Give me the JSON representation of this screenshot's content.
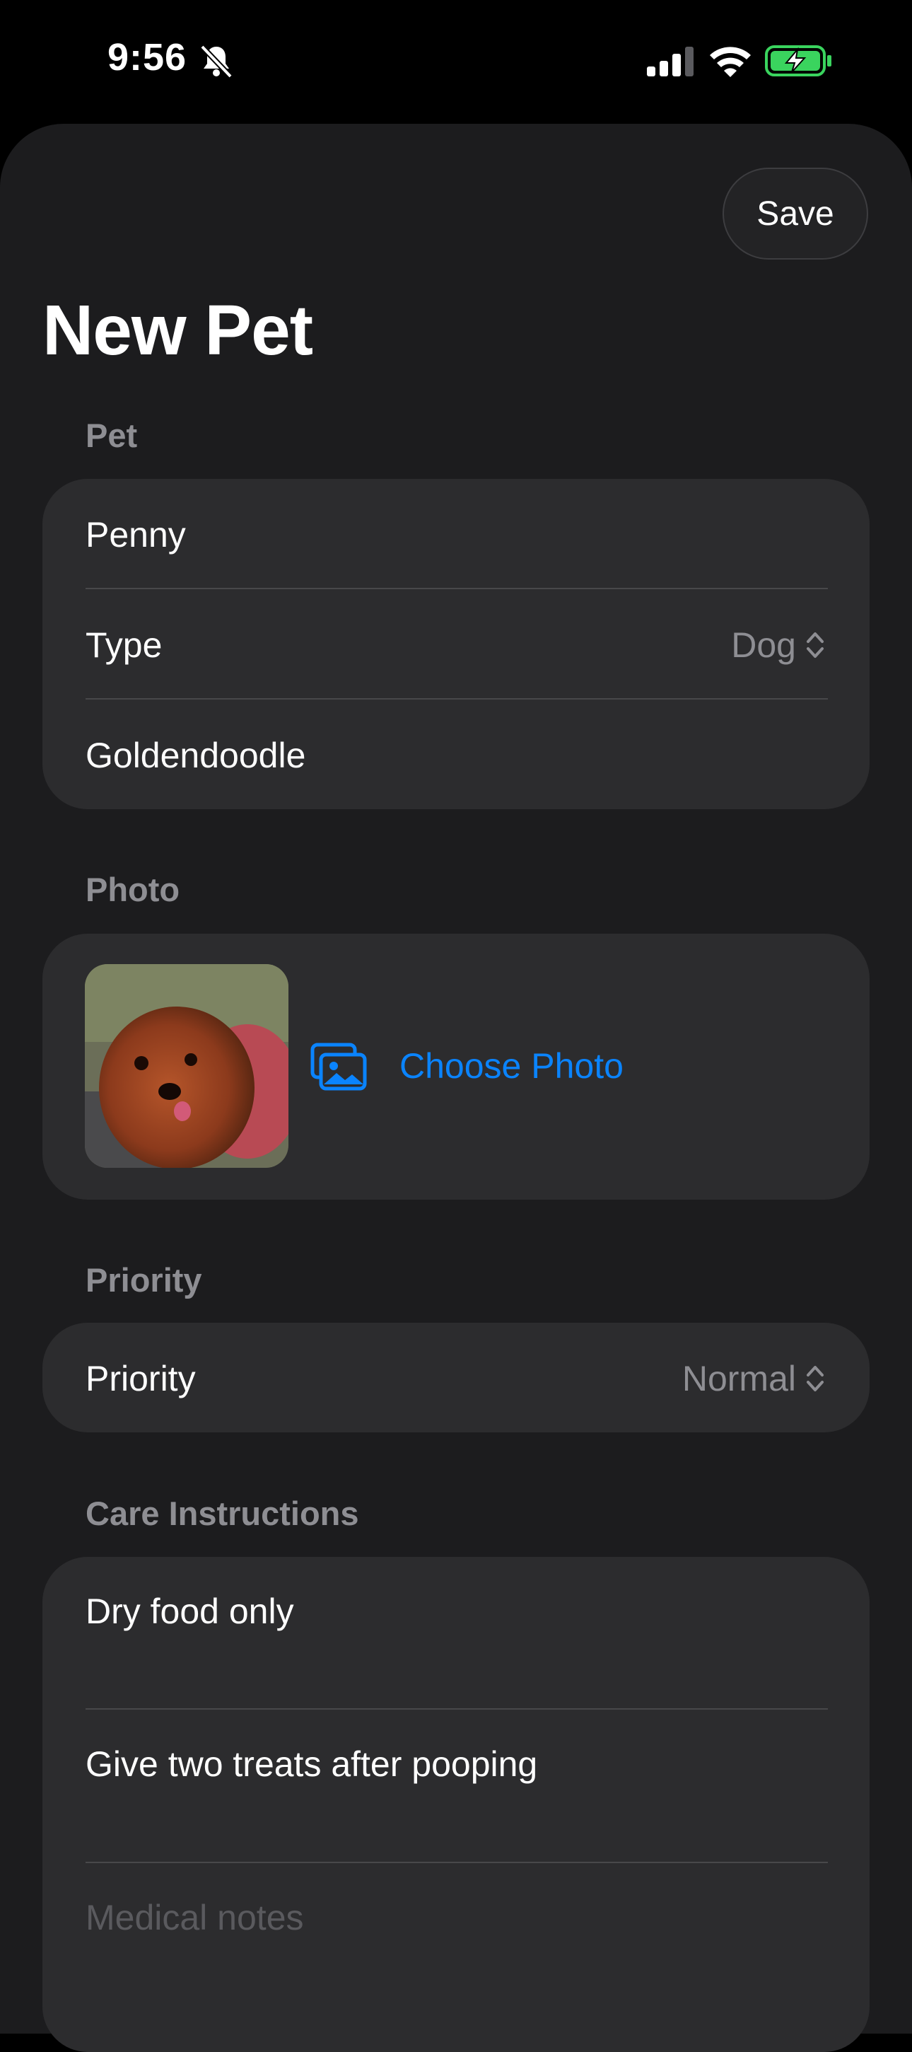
{
  "status_bar": {
    "time": "9:56",
    "battery_charging": true
  },
  "header": {
    "save_label": "Save",
    "title": "New Pet"
  },
  "sections": {
    "pet": {
      "header": "Pet",
      "name_value": "Penny",
      "type_label": "Type",
      "type_value": "Dog",
      "breed_value": "Goldendoodle"
    },
    "photo": {
      "header": "Photo",
      "choose_label": "Choose Photo"
    },
    "priority": {
      "header": "Priority",
      "label": "Priority",
      "value": "Normal"
    },
    "care": {
      "header": "Care Instructions",
      "instructions": [
        "Dry food only",
        "Give two treats after pooping"
      ],
      "medical_placeholder": "Medical notes"
    }
  },
  "colors": {
    "accent": "#0a84ff",
    "background": "#1c1c1e",
    "group": "#2c2c2e",
    "secondary_text": "#8e8e93"
  },
  "icons": [
    "bell-slash-icon",
    "cellular-signal-icon",
    "wifi-icon",
    "battery-charging-icon",
    "chevron-up-down-icon",
    "photo-stack-icon"
  ]
}
